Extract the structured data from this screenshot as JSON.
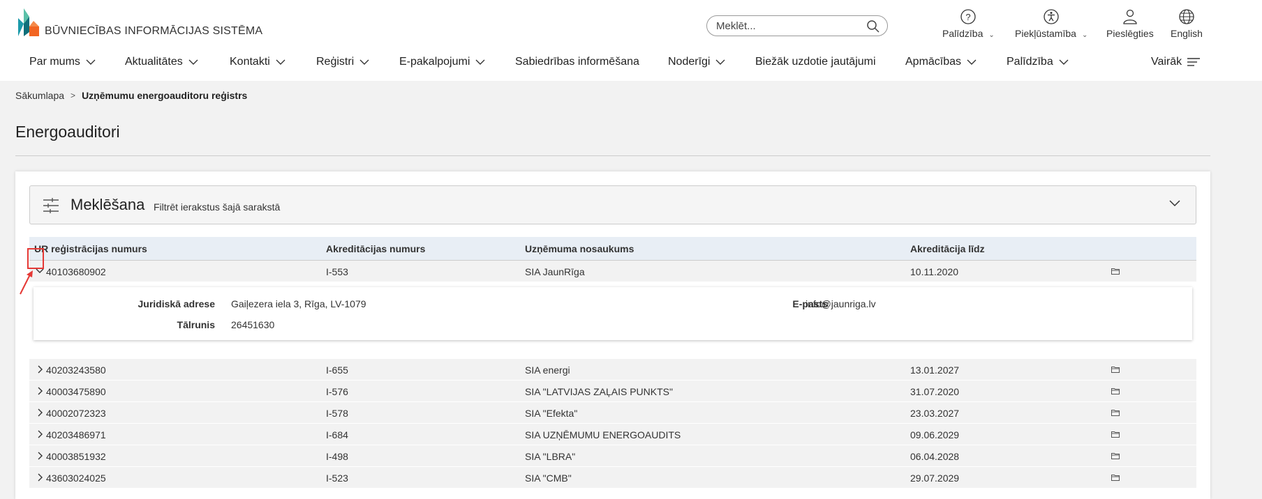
{
  "header": {
    "logo_text": "BŪVNIECĪBAS INFORMĀCIJAS SISTĒMA",
    "search_placeholder": "Meklēt...",
    "utilities": [
      {
        "label": "Palīdzība",
        "icon": "help-circle-icon"
      },
      {
        "label": "Piekļūstamība",
        "icon": "accessibility-icon"
      },
      {
        "label": "Pieslēgties",
        "icon": "user-icon"
      },
      {
        "label": "English",
        "icon": "globe-icon"
      }
    ]
  },
  "nav": {
    "items": [
      "Par mums",
      "Aktualitātes",
      "Kontakti",
      "Reģistri",
      "E-pakalpojumi",
      "Sabiedrības informēšana",
      "Noderīgi",
      "Biežāk uzdotie jautājumi",
      "Apmācības",
      "Palīdzība"
    ],
    "more": "Vairāk"
  },
  "breadcrumb": {
    "home": "Sākumlapa",
    "current": "Uzņēmumu energoauditoru reģistrs"
  },
  "page": {
    "title": "Energoauditori"
  },
  "filter": {
    "title": "Meklēšana",
    "subtitle": "Filtrēt ierakstus šajā sarakstā"
  },
  "table": {
    "headers": [
      "UR reģistrācijas numurs",
      "Akreditācijas numurs",
      "Uzņēmuma nosaukums",
      "Akreditācija līdz"
    ],
    "expanded_row": {
      "reg": "40103680902",
      "acc": "I-553",
      "name": "SIA JaunRīga",
      "until": "10.11.2020"
    },
    "detail": {
      "address_label": "Juridiskā adrese",
      "address": "Gaiļezera iela 3, Rīga, LV-1079",
      "phone_label": "Tālrunis",
      "phone": "26451630",
      "email_label": "E-pasts",
      "email": "info@jaunriga.lv"
    },
    "rows": [
      {
        "reg": "40203243580",
        "acc": "I-655",
        "name": "SIA energi",
        "until": "13.01.2027"
      },
      {
        "reg": "40003475890",
        "acc": "I-576",
        "name": "SIA \"LATVIJAS ZAĻAIS PUNKTS\"",
        "until": "31.07.2020"
      },
      {
        "reg": "40002072323",
        "acc": "I-578",
        "name": "SIA \"Efekta\"",
        "until": "23.03.2027"
      },
      {
        "reg": "40203486971",
        "acc": "I-684",
        "name": "SIA UZŅĒMUMU ENERGOAUDITS",
        "until": "09.06.2029"
      },
      {
        "reg": "40003851932",
        "acc": "I-498",
        "name": "SIA \"LBRA\"",
        "until": "06.04.2028"
      },
      {
        "reg": "43603024025",
        "acc": "I-523",
        "name": "SIA \"CMB\"",
        "until": "29.07.2029"
      }
    ]
  },
  "colors": {
    "logo_teal": "#1b9aaa",
    "logo_orange": "#f26522",
    "header_bg": "#e8eef5",
    "annotation_red": "#e53935"
  }
}
